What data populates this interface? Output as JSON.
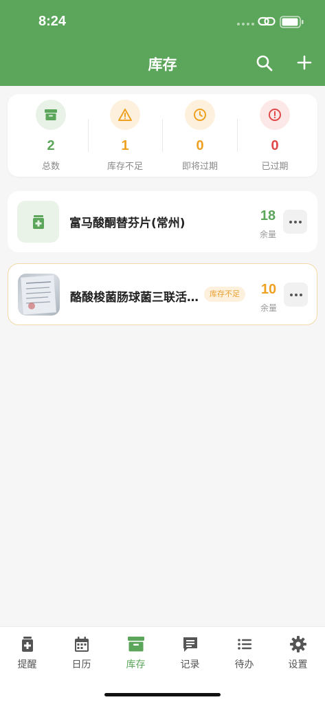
{
  "status": {
    "time": "8:24"
  },
  "header": {
    "title": "库存"
  },
  "stats": [
    {
      "value": "2",
      "label": "总数",
      "color": "#5ba65a",
      "bg": "#e8f2e6",
      "icon": "archive-icon"
    },
    {
      "value": "1",
      "label": "库存不足",
      "color": "#eea020",
      "bg": "#fdf0dc",
      "icon": "warning-icon"
    },
    {
      "value": "0",
      "label": "即将过期",
      "color": "#eea020",
      "bg": "#fdf0dc",
      "icon": "clock-icon"
    },
    {
      "value": "0",
      "label": "已过期",
      "color": "#e04848",
      "bg": "#fde8e8",
      "icon": "alert-circle-icon"
    }
  ],
  "items": [
    {
      "name": "富马酸酮替芬片(常州)",
      "quantity": "18",
      "quantity_label": "余量",
      "badge": ""
    },
    {
      "name": "酪酸梭菌肠球菌三联活菌片",
      "quantity": "10",
      "quantity_label": "余量",
      "badge": "库存不足"
    }
  ],
  "tabs": [
    {
      "label": "提醒",
      "icon": "medicine-icon",
      "active": false
    },
    {
      "label": "日历",
      "icon": "calendar-icon",
      "active": false
    },
    {
      "label": "库存",
      "icon": "archive-icon",
      "active": true
    },
    {
      "label": "记录",
      "icon": "message-icon",
      "active": false
    },
    {
      "label": "待办",
      "icon": "list-icon",
      "active": false
    },
    {
      "label": "设置",
      "icon": "gear-icon",
      "active": false
    }
  ],
  "colors": {
    "primary": "#5ba65a",
    "warning": "#eea020",
    "danger": "#e04848"
  }
}
